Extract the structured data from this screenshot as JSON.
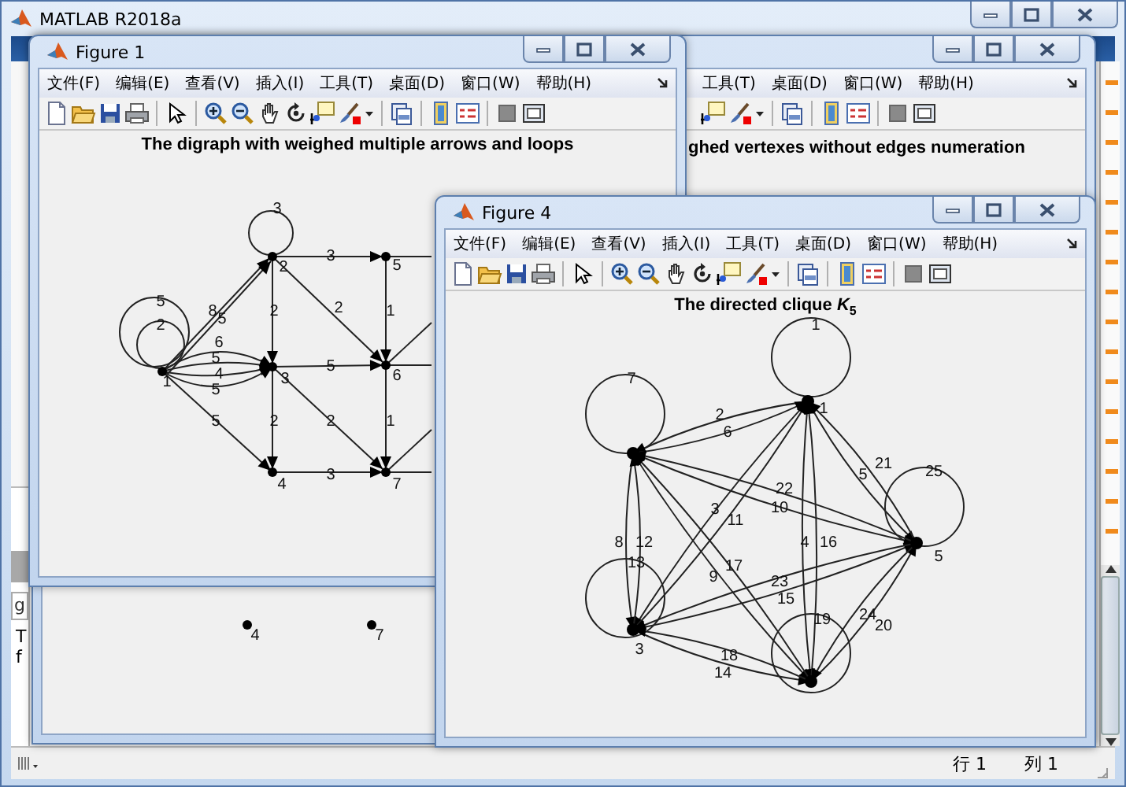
{
  "main_window": {
    "title": "MATLAB R2018a",
    "left_panel_texts": [
      "g",
      "T",
      "f"
    ],
    "status_bar": {
      "row": "行 1",
      "column": "列 1"
    }
  },
  "background_figure": {
    "menu": [
      "工具(T)",
      "桌面(D)",
      "窗口(W)",
      "帮助(H)"
    ],
    "axes_title": "ghed vertexes without edges numeration",
    "node_labels": [
      "4",
      "7"
    ]
  },
  "figure_1": {
    "title": "Figure 1",
    "menu": [
      "文件(F)",
      "编辑(E)",
      "查看(V)",
      "插入(I)",
      "工具(T)",
      "桌面(D)",
      "窗口(W)",
      "帮助(H)"
    ],
    "axes_title": "The digraph with weighed multiple arrows and loops",
    "node_labels": [
      "1",
      "2",
      "3",
      "4",
      "5",
      "6",
      "7"
    ],
    "edge_labels": [
      "5",
      "2",
      "3",
      "8",
      "5",
      "6",
      "5",
      "4",
      "5",
      "5",
      "3",
      "2",
      "2",
      "5",
      "2",
      "2",
      "1",
      "1",
      "3"
    ]
  },
  "figure_4": {
    "title": "Figure 4",
    "menu": [
      "文件(F)",
      "编辑(E)",
      "查看(V)",
      "插入(I)",
      "工具(T)",
      "桌面(D)",
      "窗口(W)",
      "帮助(H)"
    ],
    "axes_title": "The directed clique *K*$_{5}$",
    "node_labels": [
      "1",
      "5",
      "3"
    ],
    "edge_labels": [
      "1",
      "7",
      "25",
      "13",
      "19",
      "2",
      "6",
      "21",
      "5",
      "22",
      "10",
      "3",
      "11",
      "8",
      "12",
      "4",
      "16",
      "9",
      "17",
      "23",
      "15",
      "24",
      "20",
      "18",
      "14"
    ]
  }
}
